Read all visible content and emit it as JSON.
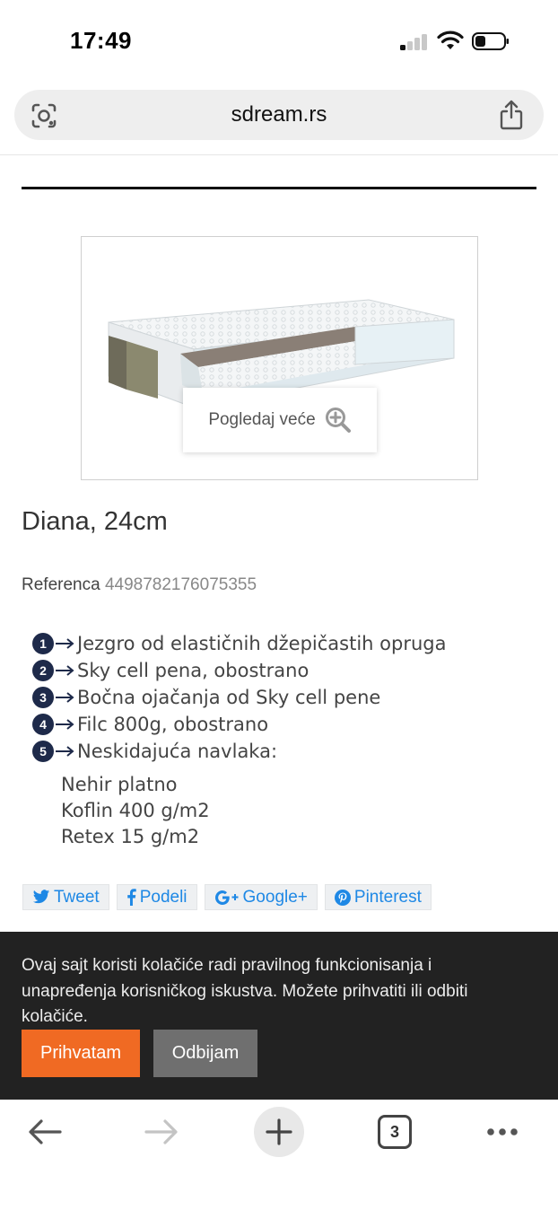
{
  "status_bar": {
    "time": "17:49"
  },
  "address_bar": {
    "url": "sdream.rs"
  },
  "product": {
    "image_button_label": "Pogledaj veće",
    "title": "Diana, 24cm",
    "reference_label": "Referenca",
    "reference_value": "4498782176075355",
    "features": [
      {
        "num": "1",
        "text": "Jezgro od elastičnih džepičastih opruga"
      },
      {
        "num": "2",
        "text": "Sky cell pena, obostrano"
      },
      {
        "num": "3",
        "text": "Bočna ojačanja od Sky cell pene"
      },
      {
        "num": "4",
        "text": "Filc 800g, obostrano"
      },
      {
        "num": "5",
        "text": "Neskidajuća navlaka:"
      }
    ],
    "cover_materials": [
      "Nehir platno",
      "Koflin 400 g/m2",
      "Retex 15 g/m2"
    ]
  },
  "share": {
    "tweet": "Tweet",
    "podeli": "Podeli",
    "google": "Google+",
    "pinterest": "Pinterest"
  },
  "cookie_banner": {
    "text": "Ovaj sajt koristi kolačiće radi pravilnog funkcionisanja i unapređenja korisničkog iskustva. Možete prihvatiti ili odbiti kolačiće.",
    "accept": "Prihvatam",
    "reject": "Odbijam"
  },
  "toolbar": {
    "tab_count": "3"
  },
  "colors": {
    "accent": "#f06a23",
    "share_blue": "#1e88e5",
    "banner_bg": "#222222",
    "badge_navy": "#1e2a4a"
  },
  "icons": [
    "signal-icon",
    "wifi-icon",
    "battery-icon",
    "lens-icon",
    "share-icon",
    "zoom-in-icon",
    "twitter-icon",
    "facebook-icon",
    "google-plus-icon",
    "pinterest-icon",
    "back-arrow-icon",
    "forward-arrow-icon",
    "plus-icon",
    "tabs-icon",
    "more-icon"
  ]
}
